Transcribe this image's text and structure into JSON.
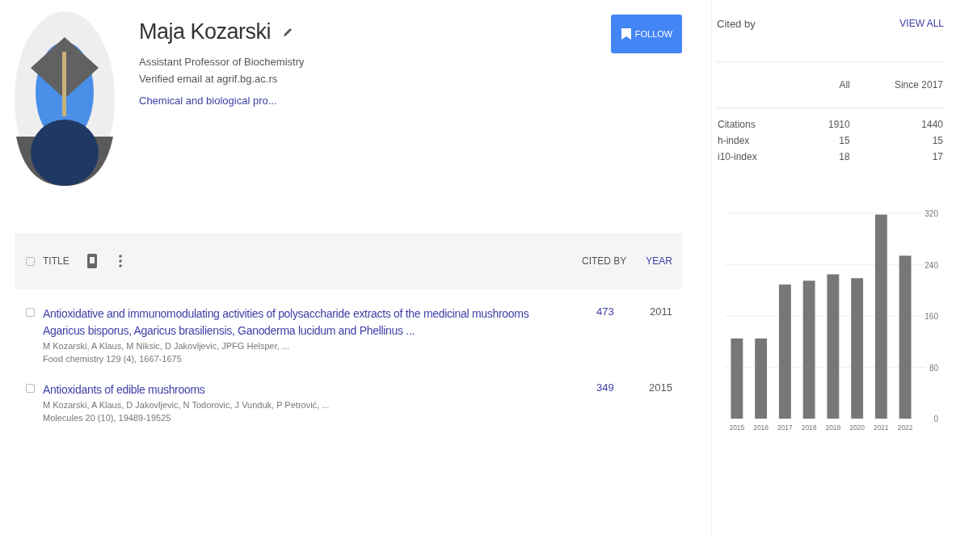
{
  "profile": {
    "name": "Maja Kozarski",
    "affiliation": "Assistant Professor of Biochemistry",
    "email": "Verified email at agrif.bg.ac.rs",
    "interests": [
      "Chemical and biological pro..."
    ],
    "follow_label": "FOLLOW"
  },
  "articles": {
    "select_all_checked": false,
    "columns": [
      {
        "label": "TITLE",
        "selected": false
      },
      {
        "label": "CITED BY",
        "selected": false
      },
      {
        "label": "YEAR",
        "selected": true
      }
    ],
    "rows": [
      {
        "checked": false,
        "title": "Antioxidative and immunomodulating activities of polysaccharide extracts of the medicinal mushrooms Agaricus bisporus, Agaricus brasiliensis, Ganoderma lucidum and Phellinus ...",
        "authors": "M Kozarski, A Klaus, M Niksic, D Jakovljevic, JPFG Helsper, ...",
        "venue": "Food chemistry 129 (4), 1667-1675",
        "cited_by": "473",
        "year": "2011"
      },
      {
        "checked": false,
        "title": "Antioxidants of edible mushrooms",
        "authors": "M Kozarski, A Klaus, D Jakovljevic, N Todorovic, J Vunduk, P Petrović, ...",
        "venue": "Molecules 20 (10), 19489-19525",
        "cited_by": "349",
        "year": "2015"
      }
    ]
  },
  "cited_by": {
    "title": "Cited by",
    "view_all": "VIEW ALL",
    "columns": [
      "All",
      "Since 2017"
    ],
    "rows": [
      {
        "label": "Citations",
        "all": "1910",
        "since": "1440"
      },
      {
        "label": "h-index",
        "all": "15",
        "since": "15"
      },
      {
        "label": "i10-index",
        "all": "18",
        "since": "17"
      }
    ],
    "chart_data": {
      "type": "bar",
      "categories": [
        "2015",
        "2016",
        "2017",
        "2018",
        "2019",
        "2020",
        "2021",
        "2022"
      ],
      "series": [
        {
          "color": "#777777",
          "values": [
            125,
            125,
            209,
            215,
            225,
            219,
            318,
            254
          ]
        }
      ],
      "grid": true,
      "ylim": [
        0,
        320
      ],
      "yticks": [
        0,
        80,
        160,
        240,
        320
      ]
    }
  }
}
